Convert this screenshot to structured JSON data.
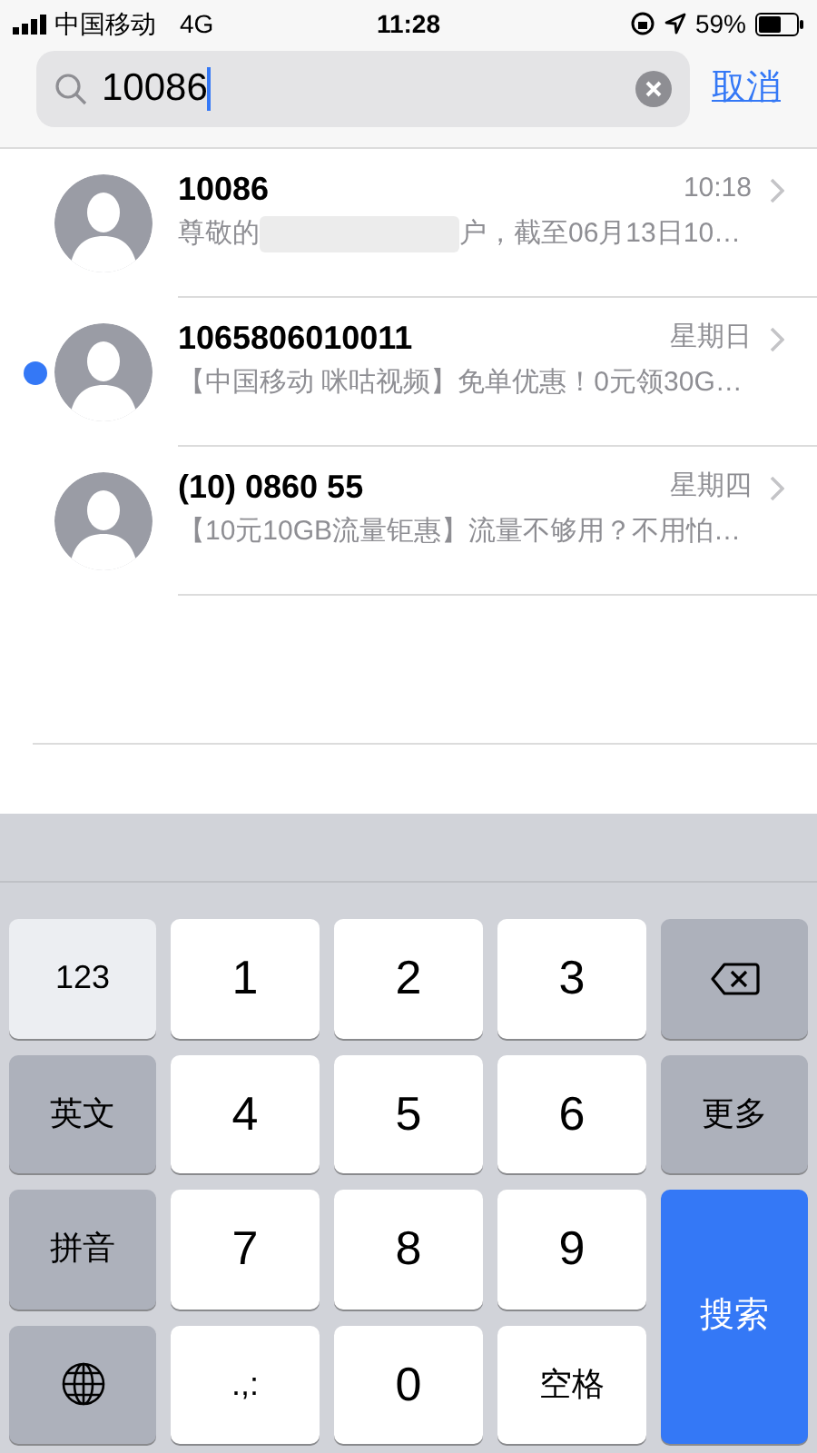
{
  "status_bar": {
    "carrier": "中国移动",
    "network": "4G",
    "time": "11:28",
    "battery": "59%"
  },
  "search": {
    "value": "10086",
    "cancel": "取消"
  },
  "messages": [
    {
      "sender": "10086",
      "time": "10:18",
      "preview": "尊敬的",
      "preview_after_blur": "户，截至06月13日10…",
      "unread": false
    },
    {
      "sender": "1065806010011",
      "time": "星期日",
      "preview": "【中国移动 咪咕视频】免单优惠！0元领30G…",
      "unread": true
    },
    {
      "sender": "(10) 0860 55",
      "time": "星期四",
      "preview": "【10元10GB流量钜惠】流量不够用？不用怕…",
      "unread": false
    }
  ],
  "keyboard": [
    {
      "kind": "light",
      "label": "123"
    },
    {
      "kind": "digit",
      "label": "1"
    },
    {
      "kind": "digit",
      "label": "2"
    },
    {
      "kind": "digit",
      "label": "3"
    },
    {
      "kind": "delete"
    },
    {
      "kind": "function",
      "label": "英文"
    },
    {
      "kind": "digit",
      "label": "4"
    },
    {
      "kind": "digit",
      "label": "5"
    },
    {
      "kind": "digit",
      "label": "6"
    },
    {
      "kind": "function",
      "label": "更多"
    },
    {
      "kind": "function",
      "label": "拼音"
    },
    {
      "kind": "digit",
      "label": "7"
    },
    {
      "kind": "digit",
      "label": "8"
    },
    {
      "kind": "digit",
      "label": "9"
    },
    {
      "kind": "action",
      "label": "搜索"
    },
    {
      "kind": "globe"
    },
    {
      "kind": "digit",
      "label": ".,:"
    },
    {
      "kind": "digit",
      "label": "0"
    },
    {
      "kind": "digit",
      "label": "空格"
    }
  ]
}
